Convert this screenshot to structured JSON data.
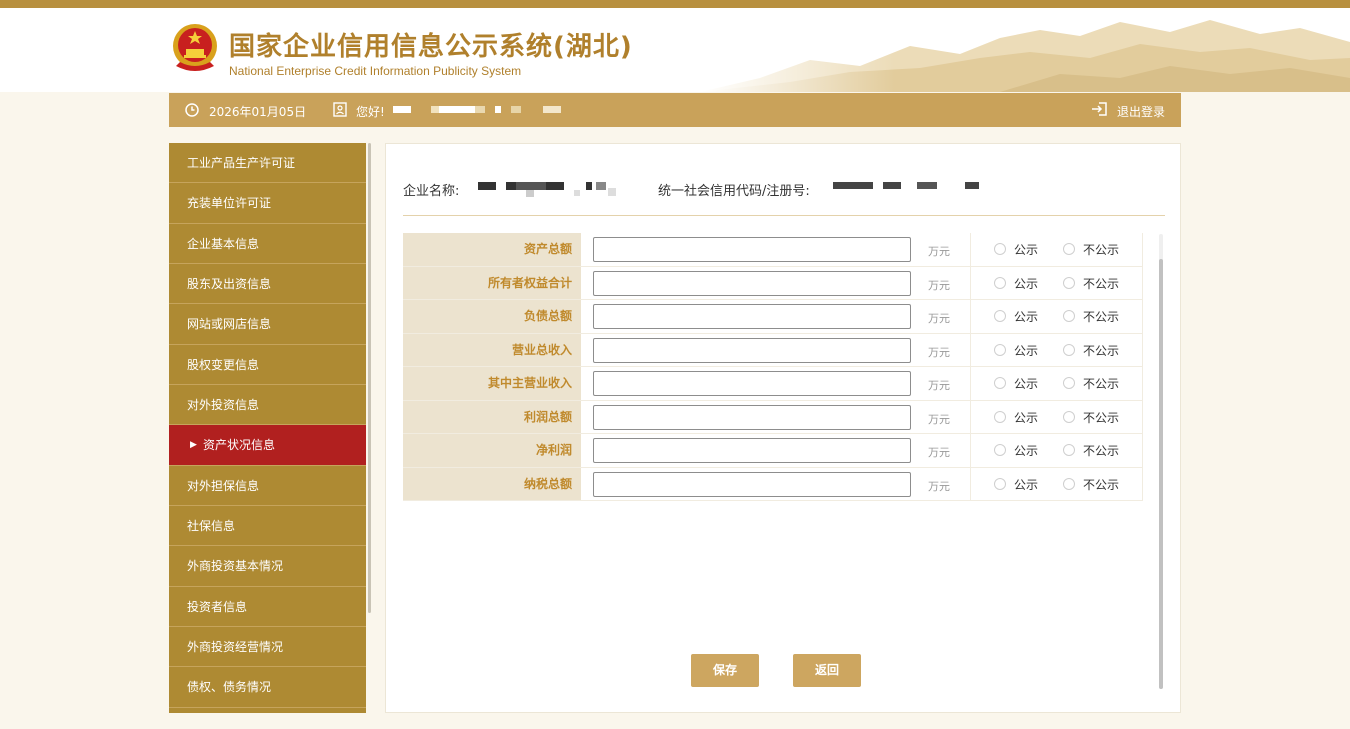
{
  "header": {
    "title_cn": "国家企业信用信息公示系统(湖北)",
    "title_en": "National Enterprise Credit Information Publicity System"
  },
  "infobar": {
    "date": "2026年01月05日",
    "greeting": "您好!",
    "logout": "退出登录"
  },
  "sidebar": {
    "items": [
      {
        "label": "工业产品生产许可证",
        "active": false
      },
      {
        "label": "充装单位许可证",
        "active": false
      },
      {
        "label": "企业基本信息",
        "active": false
      },
      {
        "label": "股东及出资信息",
        "active": false
      },
      {
        "label": "网站或网店信息",
        "active": false
      },
      {
        "label": "股权变更信息",
        "active": false
      },
      {
        "label": "对外投资信息",
        "active": false
      },
      {
        "label": "资产状况信息",
        "active": true
      },
      {
        "label": "对外担保信息",
        "active": false
      },
      {
        "label": "社保信息",
        "active": false
      },
      {
        "label": "外商投资基本情况",
        "active": false
      },
      {
        "label": "投资者信息",
        "active": false
      },
      {
        "label": "外商投资经营情况",
        "active": false
      },
      {
        "label": "债权、债务情况",
        "active": false
      }
    ]
  },
  "company": {
    "name_label": "企业名称:",
    "code_label": "统一社会信用代码/注册号:"
  },
  "form": {
    "unit": "万元",
    "public_label": "公示",
    "private_label": "不公示",
    "rows": [
      {
        "label": "资产总额",
        "value": ""
      },
      {
        "label": "所有者权益合计",
        "value": ""
      },
      {
        "label": "负债总额",
        "value": ""
      },
      {
        "label": "营业总收入",
        "value": ""
      },
      {
        "label": "其中主营业收入",
        "value": ""
      },
      {
        "label": "利润总额",
        "value": ""
      },
      {
        "label": "净利润",
        "value": ""
      },
      {
        "label": "纳税总额",
        "value": ""
      }
    ]
  },
  "buttons": {
    "save": "保存",
    "back": "返回"
  },
  "colors": {
    "accent": "#c9a25a",
    "sidebar": "#ae8a33",
    "active": "#b1201f",
    "label_text": "#c08a2d"
  }
}
